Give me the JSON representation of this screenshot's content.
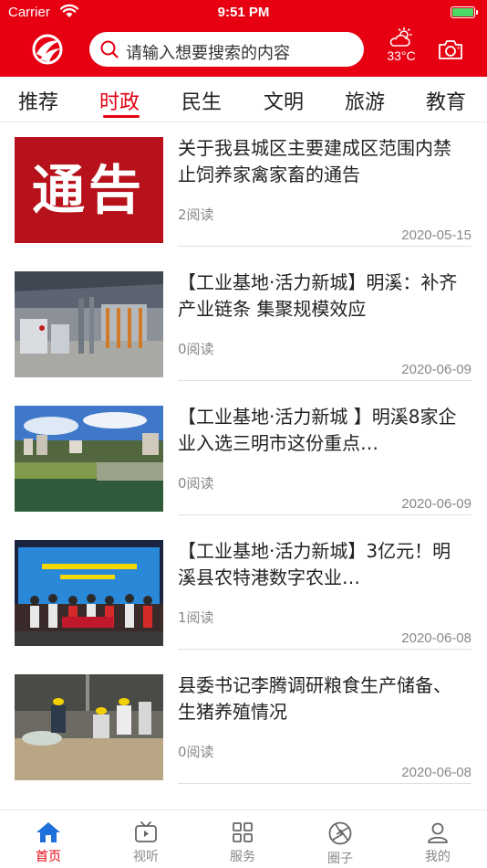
{
  "status_bar": {
    "carrier": "Carrier",
    "time": "9:51 PM"
  },
  "header": {
    "search_placeholder": "请输入想要搜索的内容",
    "temperature": "33°C",
    "icons": [
      "app-logo-icon",
      "search-icon",
      "weather-cloud-sun-icon",
      "camera-icon"
    ],
    "accent_color": "#e60012"
  },
  "tabs": [
    {
      "label": "推荐",
      "active": false
    },
    {
      "label": "时政",
      "active": true
    },
    {
      "label": "民生",
      "active": false
    },
    {
      "label": "文明",
      "active": false
    },
    {
      "label": "旅游",
      "active": false
    },
    {
      "label": "教育",
      "active": false
    }
  ],
  "news": [
    {
      "title": "关于我县城区主要建成区范围内禁止饲养家禽家畜的通告",
      "reads": "2阅读",
      "date": "2020-05-15",
      "image_text": "通告",
      "image": "notice-banner"
    },
    {
      "title": "【工业基地·活力新城】明溪：补齐产业链条 集聚规模效应",
      "reads": "0阅读",
      "date": "2020-06-09",
      "image": "factory-workshop-photo"
    },
    {
      "title": "【工业基地·活力新城 】明溪8家企业入选三明市这份重点…",
      "reads": "0阅读",
      "date": "2020-06-09",
      "image": "river-town-photo"
    },
    {
      "title": "【工业基地·活力新城】3亿元！明溪县农特港数字农业…",
      "reads": "1阅读",
      "date": "2020-06-08",
      "image": "signing-ceremony-photo"
    },
    {
      "title": "县委书记李腾调研粮食生产储备、生猪养殖情况",
      "reads": "0阅读",
      "date": "2020-06-08",
      "image": "grain-warehouse-photo"
    }
  ],
  "bottom_nav": [
    {
      "label": "首页",
      "icon": "home-icon",
      "active": true
    },
    {
      "label": "视听",
      "icon": "tv-icon",
      "active": false
    },
    {
      "label": "服务",
      "icon": "grid-icon",
      "active": false
    },
    {
      "label": "圈子",
      "icon": "aperture-icon",
      "active": false
    },
    {
      "label": "我的",
      "icon": "user-icon",
      "active": false
    }
  ]
}
